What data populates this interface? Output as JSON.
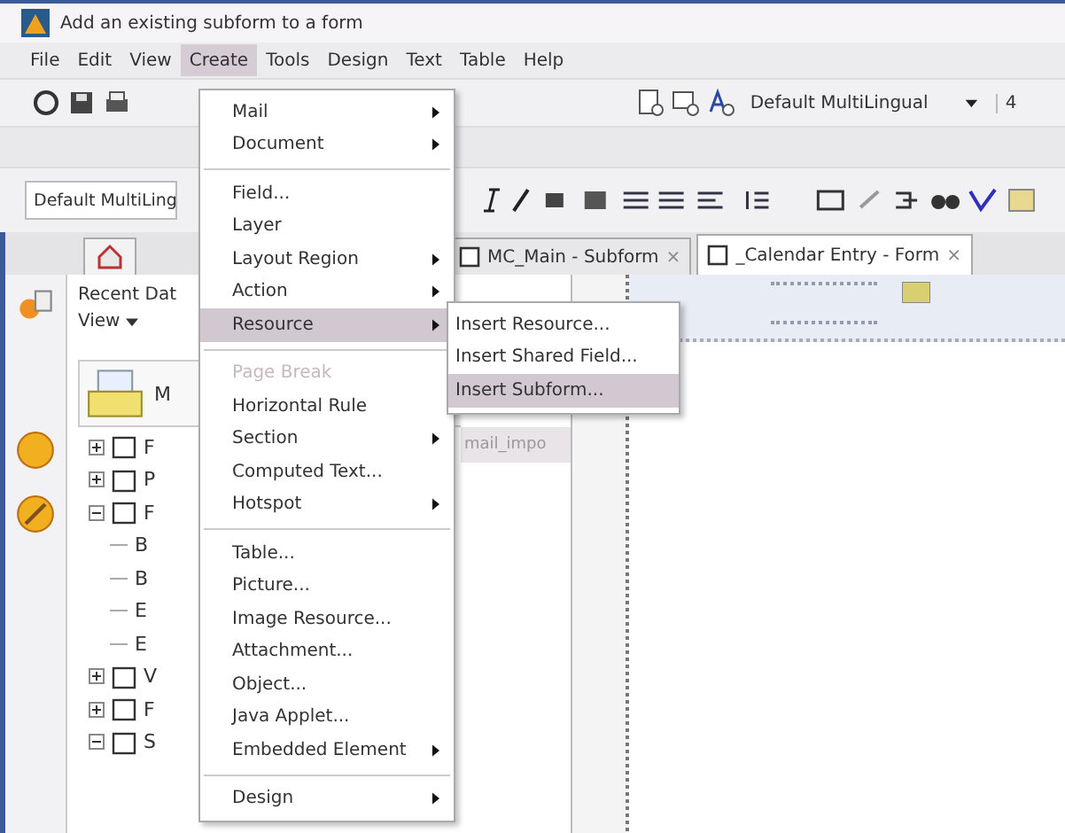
{
  "window": {
    "title": "Add an existing subform to a form"
  },
  "menu_bar": [
    {
      "label": "File",
      "selected": false
    },
    {
      "label": "Edit",
      "selected": false
    },
    {
      "label": "View",
      "selected": false
    },
    {
      "label": "Create",
      "selected": true
    },
    {
      "label": "Tools",
      "selected": false
    },
    {
      "label": "Design",
      "selected": false
    },
    {
      "label": "Text",
      "selected": false
    },
    {
      "label": "Table",
      "selected": false
    },
    {
      "label": "Help",
      "selected": false
    }
  ],
  "toolbar": {
    "font_dropdown": "Default MultiLingual",
    "size_field": "4"
  },
  "format_bar": {
    "font_dropdown": "Default MultiLing"
  },
  "tabs": [
    {
      "label": "MC_Main - Subform",
      "close": "×",
      "selected": false
    },
    {
      "label": "_Calendar Entry - Form",
      "close": "×",
      "selected": true
    }
  ],
  "navigator": {
    "title": "Recent Dat",
    "view_button": "View",
    "database": "M",
    "column_header": "mail_impo"
  },
  "tree": [
    {
      "label": "F",
      "expanded": false
    },
    {
      "label": "P",
      "expanded": false
    },
    {
      "label": "F",
      "expanded": true,
      "children": [
        {
          "label": "B"
        },
        {
          "label": "B"
        },
        {
          "label": "E"
        },
        {
          "label": "E"
        }
      ]
    },
    {
      "label": "V",
      "expanded": false
    },
    {
      "label": "F",
      "expanded": false
    },
    {
      "label": "S",
      "expanded": true
    }
  ],
  "create_menu": [
    {
      "kind": "item",
      "label": "Mail",
      "submenu": true,
      "disabled": false,
      "selected": false
    },
    {
      "kind": "item",
      "label": "Document",
      "submenu": true,
      "disabled": false,
      "selected": false
    },
    {
      "kind": "separator"
    },
    {
      "kind": "item",
      "label": "Field...",
      "submenu": false,
      "disabled": false,
      "selected": false
    },
    {
      "kind": "item",
      "label": "Layer",
      "submenu": false,
      "disabled": false,
      "selected": false
    },
    {
      "kind": "item",
      "label": "Layout Region",
      "submenu": true,
      "disabled": false,
      "selected": false
    },
    {
      "kind": "item",
      "label": "Action",
      "submenu": true,
      "disabled": false,
      "selected": false
    },
    {
      "kind": "item",
      "label": "Resource",
      "submenu": true,
      "disabled": false,
      "selected": true
    },
    {
      "kind": "separator"
    },
    {
      "kind": "item",
      "label": "Page Break",
      "submenu": false,
      "disabled": true,
      "selected": false
    },
    {
      "kind": "item",
      "label": "Horizontal Rule",
      "submenu": false,
      "disabled": false,
      "selected": false
    },
    {
      "kind": "item",
      "label": "Section",
      "submenu": true,
      "disabled": false,
      "selected": false
    },
    {
      "kind": "item",
      "label": "Computed Text...",
      "submenu": false,
      "disabled": false,
      "selected": false
    },
    {
      "kind": "item",
      "label": "Hotspot",
      "submenu": true,
      "disabled": false,
      "selected": false
    },
    {
      "kind": "separator"
    },
    {
      "kind": "item",
      "label": "Table...",
      "submenu": false,
      "disabled": false,
      "selected": false
    },
    {
      "kind": "item",
      "label": "Picture...",
      "submenu": false,
      "disabled": false,
      "selected": false
    },
    {
      "kind": "item",
      "label": "Image Resource...",
      "submenu": false,
      "disabled": false,
      "selected": false
    },
    {
      "kind": "item",
      "label": "Attachment...",
      "submenu": false,
      "disabled": false,
      "selected": false
    },
    {
      "kind": "item",
      "label": "Object...",
      "submenu": false,
      "disabled": false,
      "selected": false
    },
    {
      "kind": "item",
      "label": "Java Applet...",
      "submenu": false,
      "disabled": false,
      "selected": false
    },
    {
      "kind": "item",
      "label": "Embedded Element",
      "submenu": true,
      "disabled": false,
      "selected": false
    },
    {
      "kind": "separator"
    },
    {
      "kind": "item",
      "label": "Design",
      "submenu": true,
      "disabled": false,
      "selected": false
    }
  ],
  "resource_submenu": [
    {
      "label": "Insert Resource...",
      "selected": false
    },
    {
      "label": "Insert Shared Field...",
      "selected": false
    },
    {
      "label": "Insert Subform...",
      "selected": true
    }
  ]
}
